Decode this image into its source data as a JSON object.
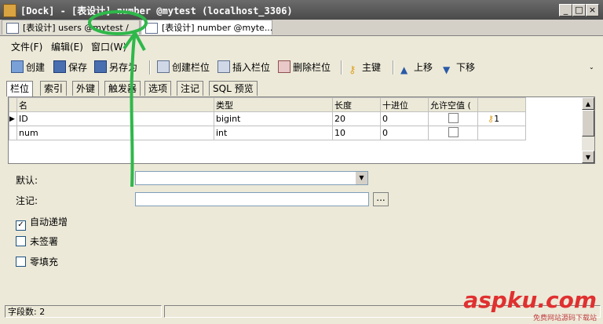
{
  "window": {
    "title": "[Dock] - [表设计] number @mytest (localhost_3306)"
  },
  "doc_tabs": [
    {
      "label": "[表设计] users @mytest /"
    },
    {
      "label": "[表设计] number @myte..."
    }
  ],
  "menu": {
    "file": "文件(F)",
    "edit": "编辑(E)",
    "window": "窗口(W)"
  },
  "toolbar": {
    "create": "创建",
    "save": "保存",
    "save_as": "另存为",
    "add_field": "创建栏位",
    "insert_field": "插入栏位",
    "delete_field": "删除栏位",
    "primary_key": "主键",
    "move_up": "上移",
    "move_down": "下移"
  },
  "sub_tabs": [
    "栏位",
    "索引",
    "外键",
    "触发器",
    "选项",
    "注记",
    "SQL 预览"
  ],
  "grid": {
    "headers": [
      "名",
      "类型",
      "长度",
      "十进位",
      "允许空值 (",
      ""
    ],
    "rows": [
      {
        "name": "ID",
        "type": "bigint",
        "length": "20",
        "decimals": "0",
        "key": "1"
      },
      {
        "name": "num",
        "type": "int",
        "length": "10",
        "decimals": "0",
        "key": ""
      }
    ]
  },
  "props": {
    "default_label": "默认:",
    "comment_label": "注记:",
    "ellipsis": "...",
    "auto_increment": "自动递增",
    "unsigned": "未签署",
    "zerofill": "零填充"
  },
  "status": {
    "field_count": "字段数: 2"
  },
  "watermark": {
    "brand": "aspku.com",
    "sub": "免费网站源码下载站"
  },
  "colors": {
    "key_icon": "#e0a020",
    "annotation": "#2fb84a",
    "watermark": "#e03030"
  }
}
